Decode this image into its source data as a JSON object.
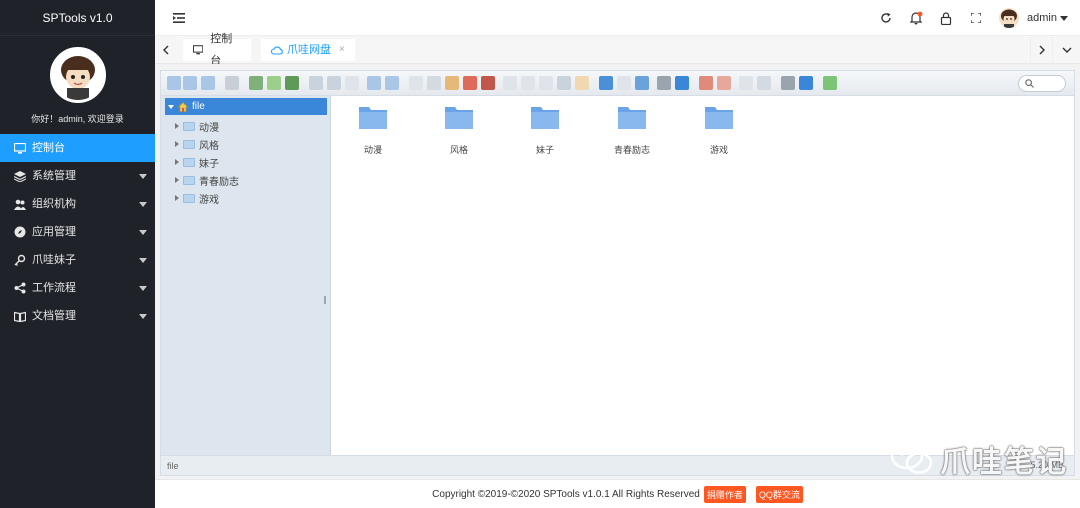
{
  "app": {
    "title": "SPTools v1.0"
  },
  "user": {
    "greeting": "你好！admin, 欢迎登录",
    "name": "admin"
  },
  "sidebar": {
    "items": [
      {
        "label": "控制台",
        "icon": "monitor-icon",
        "active": true,
        "has_caret": false
      },
      {
        "label": "系统管理",
        "icon": "layers-icon",
        "has_caret": true
      },
      {
        "label": "组织机构",
        "icon": "users-icon",
        "has_caret": true
      },
      {
        "label": "应用管理",
        "icon": "compass-icon",
        "has_caret": true
      },
      {
        "label": "爪哇妹子",
        "icon": "key-icon",
        "has_caret": true
      },
      {
        "label": "工作流程",
        "icon": "share-icon",
        "has_caret": true
      },
      {
        "label": "文档管理",
        "icon": "book-icon",
        "has_caret": true
      }
    ]
  },
  "header": {
    "icons": [
      "refresh-icon",
      "notification-icon",
      "lock-icon",
      "fullscreen-icon"
    ],
    "accent": "#1e9fff",
    "notify_dot": "#ff5722"
  },
  "tabs": [
    {
      "label": "控制台",
      "icon": "monitor-icon",
      "closable": false
    },
    {
      "label": "爪哇网盘",
      "icon": "cloud-icon",
      "closable": true,
      "close_glyph": "×",
      "active": true
    }
  ],
  "file_manager": {
    "search_placeholder": "",
    "tree_root": "file",
    "tree": [
      "动漫",
      "风格",
      "妹子",
      "青春励志",
      "游戏"
    ],
    "files": [
      "动漫",
      "风格",
      "妹子",
      "青春励志",
      "游戏"
    ],
    "status_path": "file",
    "status_size": "5.20 MB"
  },
  "footer": {
    "copyright": "Copyright ©2019-©2020 SPTools v1.0.1 All Rights Reserved",
    "donate": "捐赠作者",
    "qq": "QQ群交流"
  },
  "watermark": "爪哇笔记"
}
